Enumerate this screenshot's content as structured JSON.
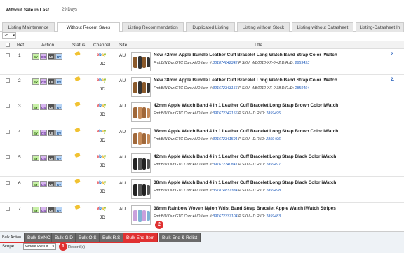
{
  "header": {
    "title": "Without Sale in Last...",
    "subtitle": "29 Days"
  },
  "tabs": [
    {
      "label": "Listing Maintenance"
    },
    {
      "label": "Without Recent Sales"
    },
    {
      "label": "Listing Recommendation"
    },
    {
      "label": "Duplicated Listing"
    },
    {
      "label": "Listing without Stock"
    },
    {
      "label": "Listing without Datasheet"
    },
    {
      "label": "Listing-Datasheet In"
    }
  ],
  "page_size": "25",
  "columns": {
    "ref": "Ref",
    "action": "Action",
    "status": "Status",
    "channel": "Channel",
    "site": "Site",
    "title": "Title"
  },
  "action_buttons": {
    "sy": "SY",
    "os": "OS",
    "ue": "UE",
    "rv": "RV"
  },
  "channel_logo": {
    "e": "e",
    "b": "b",
    "a": "a",
    "y": "y"
  },
  "rows": [
    {
      "ref": "1",
      "account": "JD",
      "site": "AU",
      "title": "New 42mm Apple Bundle Leather Cuff Bracelet Long Watch Band Strap Color iWatch",
      "fmt": "Fmt:BIN Dur:GTC Curr:AUD Item #:",
      "item": "361874842342",
      "psku_label": "P SKU:",
      "psku": "WB0010-XX-0-42",
      "drid_label": "D.R.ID:",
      "drid": "2859493",
      "extra": "2."
    },
    {
      "ref": "2",
      "account": "JD",
      "site": "AU",
      "title": "New 38mm Apple Bundle Leather Cuff Bracelet Long Watch Band Strap Color iWatch",
      "fmt": "Fmt:BIN Dur:GTC Curr:AUD Item #:",
      "item": "391672343156",
      "psku_label": "P SKU:",
      "psku": "WB0010-XX-0-38",
      "drid_label": "D.R.ID:",
      "drid": "2859494",
      "extra": "2."
    },
    {
      "ref": "3",
      "account": "JD",
      "site": "AU",
      "title": "42mm Apple Watch Band 4 in 1 Leather Cuff Bracelet Long Strap Brown Color iWatch",
      "fmt": "Fmt:BIN Dur:GTC Curr:AUD Item #:",
      "item": "391672342156",
      "psku_label": "P SKU:-",
      "psku": "",
      "drid_label": "D.R.ID:",
      "drid": "2859495",
      "extra": ""
    },
    {
      "ref": "4",
      "account": "JD",
      "site": "AU",
      "title": "38mm Apple Watch Band 4 in 1 Leather Cuff Bracelet Long Strap Brown Color iWatch",
      "fmt": "Fmt:BIN Dur:GTC Curr:AUD Item #:",
      "item": "391672341591",
      "psku_label": "P SKU:-",
      "psku": "",
      "drid_label": "D.R.ID:",
      "drid": "2859496",
      "extra": ""
    },
    {
      "ref": "5",
      "account": "JD",
      "site": "AU",
      "title": "42mm Apple Watch Band 4 in 1 Leather Cuff Bracelet Long Strap Black Color iWatch",
      "fmt": "Fmt:BIN Dur:GTC Curr:AUD Item #:",
      "item": "391672340841",
      "psku_label": "P SKU:-",
      "psku": "",
      "drid_label": "D.R.ID:",
      "drid": "2859497",
      "extra": ""
    },
    {
      "ref": "6",
      "account": "JD",
      "site": "AU",
      "title": "38mm Apple Watch Band 4 in 1 Leather Cuff Bracelet Long Strap Black Color iWatch",
      "fmt": "Fmt:BIN Dur:GTC Curr:AUD Item #:",
      "item": "361874837384",
      "psku_label": "P SKU:-",
      "psku": "",
      "drid_label": "D.R.ID:",
      "drid": "2859498",
      "extra": ""
    },
    {
      "ref": "7",
      "account": "JD",
      "site": "AU",
      "title": "38mm Rainbow Woven Nylon Wrist Band Strap Bracelet Apple Watch iWatch Stripes",
      "fmt": "Fmt:BIN Dur:GTC Curr:AUD Item #:",
      "item": "391672337104",
      "psku_label": "P SKU:-",
      "psku": "",
      "drid_label": "D.R.ID:",
      "drid": "2859483",
      "extra": ""
    }
  ],
  "bulk": {
    "label": "Bulk Action",
    "buttons": [
      "Bulk SYNC",
      "Bulk G.D",
      "Bulk O.S",
      "Bulk R.S",
      "Bulk End Item",
      "Bulk End & Relist"
    ],
    "scope_label": "Scope",
    "scope_value": "Whole Result",
    "records_text": "Record(s)"
  },
  "callouts": {
    "one": "1",
    "two": "2"
  },
  "colors": {
    "danger": "#e03131",
    "link": "#1a57b8"
  }
}
